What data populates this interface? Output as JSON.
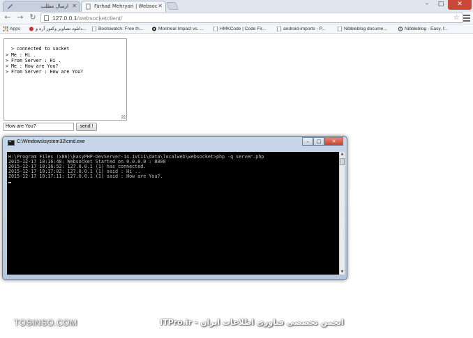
{
  "browser": {
    "tabs": [
      {
        "title": "ارسال مطلب",
        "active": false
      },
      {
        "title": "Farhad Mehryari | Websoc",
        "active": true
      }
    ],
    "url_host": "127.0.0.1",
    "url_path": "/websocketclient/",
    "bookmarks": [
      {
        "label": "Apps",
        "icon": "apps-grid-icon"
      },
      {
        "label": "دانلود تصاویر وکتور آره و...",
        "icon": "site-icon"
      },
      {
        "label": "Bootswatch: Free th...",
        "icon": "page-icon"
      },
      {
        "label": "Montreal Impact vs. ...",
        "icon": "soccer-ball-icon"
      },
      {
        "label": "HMKCode | Code Fir...",
        "icon": "page-icon"
      },
      {
        "label": "android-imports - P...",
        "icon": "page-icon"
      },
      {
        "label": "Nibbleblog docume...",
        "icon": "page-icon"
      },
      {
        "label": "Nibbleblog - Easy, f...",
        "icon": "gear-icon"
      }
    ]
  },
  "client": {
    "log": "> connected to socket\n> Me : Hi .\n> From Server : Hi .\n> Me : How are You?\n> From Server : How are You?",
    "input_value": "How are You?",
    "send_label": "send !"
  },
  "cmd": {
    "title": "C:\\Windows\\system32\\cmd.exe",
    "lines": [
      "H:\\Program Files (x86)\\EasyPHP-DevServer-14.1VC11\\data\\localweb\\websocket>php -q server.php",
      "2015-12-17 10:16:48: Websocket Started on 0.0.0.0 : 8000",
      "2015-12-17 10:16:52: 127.0.0.1 (1) has connected.",
      "2015-12-17 10:17:02: 127.0.0.1 (1) said : Hi ..",
      "2015-12-17 10:17:11: 127.0.0.1 (1) said : How are You?."
    ]
  },
  "watermark": {
    "left": "TOSINSO.COM",
    "right": "انجمن تخصصی فناوری اطلاعات ایران - ITPro.ir"
  },
  "colors": {
    "close_red": "#c9483a",
    "console_bg": "#000000",
    "console_fg": "#c0c0c0",
    "window_frame": "#b6c7dc"
  }
}
